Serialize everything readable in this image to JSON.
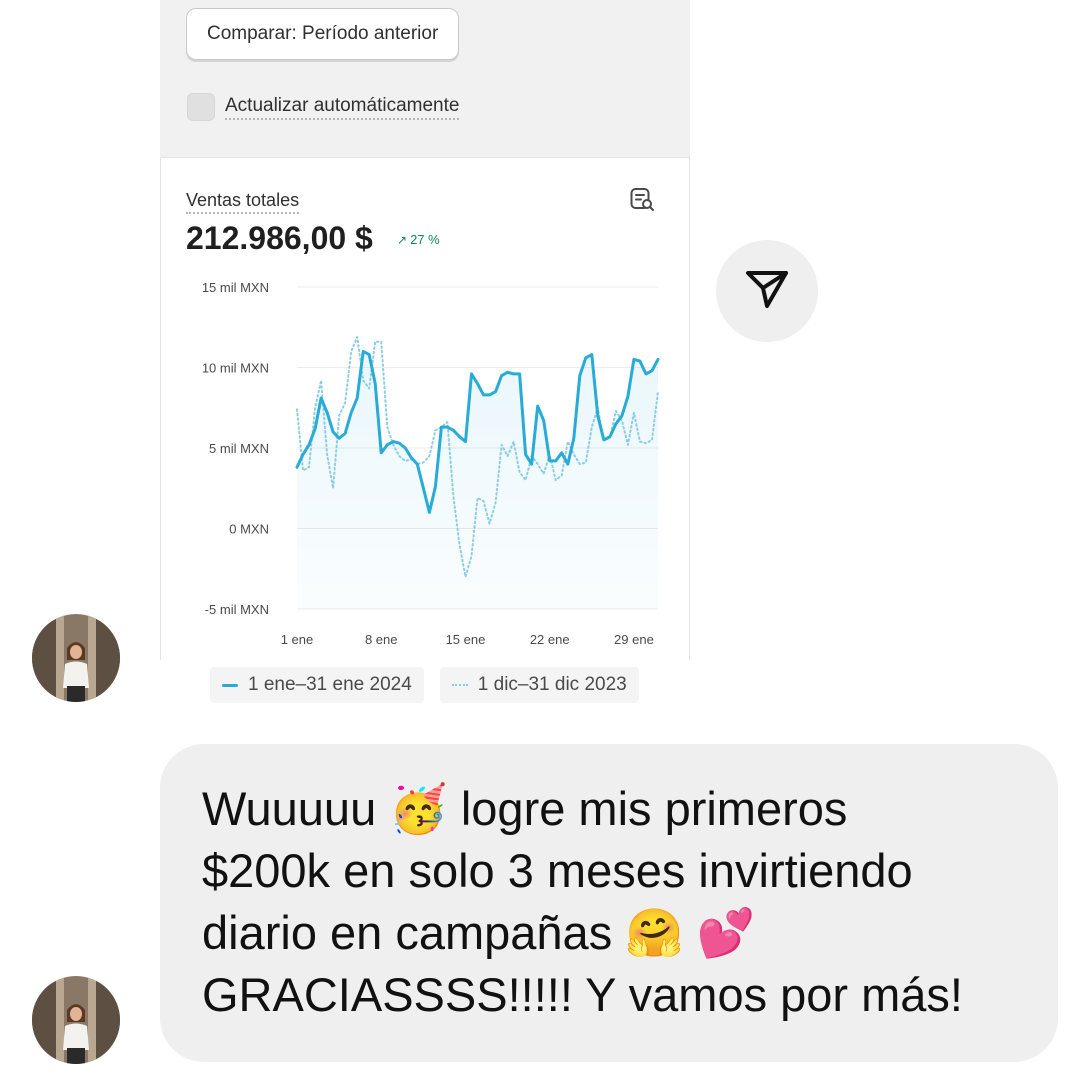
{
  "card": {
    "compare_button": "Comparar: Período anterior",
    "auto_update_label": "Actualizar automáticamente",
    "metric": {
      "label": "Ventas totales",
      "value": "212.986,00 $",
      "change_arrow": "↗",
      "change": "27 %"
    }
  },
  "chart_data": {
    "type": "line",
    "title": "",
    "y_tick_labels": [
      "15 mil MXN",
      "10 mil MXN",
      "5 mil MXN",
      "0 MXN",
      "-5 mil MXN"
    ],
    "y_ticks": [
      15000,
      10000,
      5000,
      0,
      -5000
    ],
    "ylim": [
      -5000,
      15000
    ],
    "x_tick_labels": [
      "1 ene",
      "8 ene",
      "15 ene",
      "22 ene",
      "29 ene"
    ],
    "x_tick_days": [
      1,
      8,
      15,
      22,
      29
    ],
    "xlim": [
      1,
      31
    ],
    "grid": true,
    "legend_position": "bottom",
    "series": [
      {
        "name": "1 ene–31 ene 2024",
        "style": "solid",
        "color": "#29abd7",
        "x": [
          1,
          1.5,
          2,
          2.5,
          3,
          3.5,
          4,
          4.5,
          5,
          5.5,
          6,
          6.5,
          7,
          7.5,
          8,
          8.5,
          9,
          9.5,
          10,
          10.5,
          11,
          11.5,
          12,
          12.5,
          13,
          13.5,
          14,
          14.5,
          15,
          15.5,
          16,
          16.5,
          17,
          17.5,
          18,
          18.5,
          19,
          19.5,
          20,
          20.5,
          21,
          21.5,
          22,
          22.5,
          23,
          23.5,
          24,
          24.5,
          25,
          25.5,
          26,
          26.5,
          27,
          27.5,
          28,
          28.5,
          29,
          29.5,
          30,
          30.5,
          31
        ],
        "values": [
          3800,
          4600,
          5200,
          6200,
          8100,
          7200,
          6000,
          5600,
          5900,
          7200,
          8100,
          11000,
          10800,
          9000,
          4700,
          5200,
          5400,
          5300,
          5000,
          4400,
          4000,
          2500,
          1000,
          2600,
          6300,
          6300,
          6100,
          5700,
          5400,
          9600,
          9000,
          8300,
          8300,
          8500,
          9500,
          9700,
          9600,
          9600,
          4600,
          4000,
          7600,
          6700,
          4200,
          4200,
          4700,
          4000,
          5600,
          9500,
          10600,
          10800,
          7000,
          5500,
          5700,
          6500,
          7000,
          8200,
          10500,
          10400,
          9600,
          9800,
          10500
        ]
      },
      {
        "name": "1 dic–31 dic 2023",
        "style": "dotted",
        "color": "#8ccde3",
        "x": [
          1,
          1.5,
          2,
          2.5,
          3,
          3.5,
          4,
          4.5,
          5,
          5.5,
          6,
          6.5,
          7,
          7.5,
          8,
          8.5,
          9,
          9.5,
          10,
          10.5,
          11,
          11.5,
          12,
          12.5,
          13,
          13.5,
          14,
          14.5,
          15,
          15.5,
          16,
          16.5,
          17,
          17.5,
          18,
          18.5,
          19,
          19.5,
          20,
          20.5,
          21,
          21.5,
          22,
          22.5,
          23,
          23.5,
          24,
          24.5,
          25,
          25.5,
          26,
          26.5,
          27,
          27.5,
          28,
          28.5,
          29,
          29.5,
          30,
          30.5,
          31
        ],
        "values": [
          7400,
          3600,
          3800,
          7500,
          9200,
          4600,
          2500,
          7000,
          7800,
          11000,
          11900,
          9200,
          8700,
          11600,
          11600,
          6300,
          5200,
          4500,
          4200,
          4300,
          4000,
          4100,
          4500,
          6100,
          6300,
          6600,
          2000,
          -1000,
          -3000,
          -1700,
          1900,
          1700,
          300,
          1600,
          5200,
          4500,
          5400,
          3500,
          3000,
          4500,
          4000,
          3400,
          4600,
          3000,
          3300,
          5400,
          4600,
          4000,
          4100,
          6300,
          7500,
          5500,
          5600,
          7300,
          6700,
          5200,
          7200,
          5400,
          5300,
          5500,
          8500
        ]
      }
    ]
  },
  "legend": {
    "item_current": "1 ene–31 ene 2024",
    "item_previous": "1 dic–31 dic 2023"
  },
  "message": {
    "text": "Wuuuuu 🥳 logre mis primeros\n$200k en solo 3 meses invirtiendo\ndiario en campañas 🤗 💕\nGRACIASSSS!!!!! Y vamos por más!"
  },
  "colors": {
    "series_current": "#29abd7",
    "series_previous": "#8ccde3",
    "positive_change": "#0f8a5f",
    "bubble_bg": "#efefef"
  },
  "icons": {
    "report": "report-search-icon",
    "send": "paper-plane-icon",
    "avatar": "user-avatar"
  }
}
